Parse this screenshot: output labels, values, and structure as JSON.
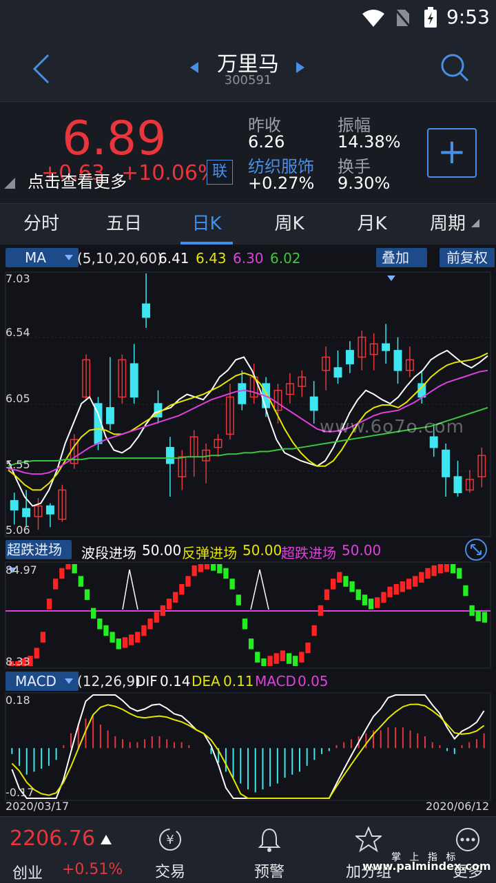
{
  "status_bar": {
    "time": "9:53"
  },
  "header": {
    "title": "万里马",
    "code": "300591"
  },
  "quote": {
    "price": "6.89",
    "change": "+0.63",
    "change_pct": "+10.06%",
    "link_badge": "联",
    "hint": "点击查看更多",
    "prev_close_label": "昨收",
    "prev_close": "6.26",
    "amplitude_label": "振幅",
    "amplitude": "14.38%",
    "sector": "纺织服饰",
    "sector_change": "+0.27%",
    "turnover_label": "换手",
    "turnover": "9.30%",
    "add_button": "+"
  },
  "tabs": [
    "分时",
    "五日",
    "日K",
    "周K",
    "月K",
    "周期"
  ],
  "active_tab": 2,
  "ma_panel": {
    "selector": "MA",
    "params": "(5,10,20,60)",
    "values": [
      "6.41",
      "6.43",
      "6.30",
      "6.02"
    ],
    "overlay_button": "叠加",
    "adjust_button": "前复权",
    "y_labels": [
      "7.03",
      "6.54",
      "6.05",
      "5.55",
      "5.06"
    ],
    "watermark": "www.6o7o.com"
  },
  "indicator_panel": {
    "selector": "超跌进场",
    "label1": "波段进场",
    "value1": "50.00",
    "label2": "反弹进场",
    "value2": "50.00",
    "label3": "超跌进场",
    "value3": "50.00",
    "y_top": "84.97",
    "y_bottom": "8.33"
  },
  "macd_panel": {
    "selector": "MACD",
    "params": "(12,26,9)",
    "dif_label": "DIF",
    "dif": "0.14",
    "dea_label": "DEA",
    "dea": "0.11",
    "macd_label": "MACD",
    "macd": "0.05",
    "y_top": "0.18",
    "y_bottom": "-0.17",
    "date_start": "2020/03/17",
    "date_end": "2020/06/12"
  },
  "bottom": {
    "index_value": "2206.76",
    "index_name": "创业",
    "index_change": "+0.51%",
    "nav": [
      "交易",
      "预警",
      "加分组",
      "更多"
    ],
    "watermark_cn": "掌 上 指 标",
    "watermark_url": "www.palmindex.com"
  },
  "colors": {
    "up": "#e8363c",
    "down": "#3ee6f2",
    "ma5": "#ffffff",
    "ma10": "#e6e600",
    "ma20": "#e040e0",
    "ma60": "#3cc83c",
    "accent": "#3d8ff0"
  },
  "chart_data": [
    {
      "type": "candlestick",
      "title": "",
      "ylim": [
        5.06,
        7.03
      ],
      "y_ticks": [
        7.03,
        6.54,
        6.05,
        5.55,
        5.06
      ],
      "x_range": [
        "2020/03/17",
        "2020/06/12"
      ],
      "series": [
        {
          "name": "MA5",
          "value": 6.41,
          "values": [
            5.62,
            5.48,
            5.35,
            5.28,
            5.3,
            5.4,
            5.55,
            5.75,
            5.9,
            6.05,
            6.1,
            5.98,
            5.8,
            5.7,
            5.68,
            5.72,
            5.8,
            5.9,
            5.98,
            6.0,
            6.02,
            6.08,
            6.12,
            6.1,
            6.08,
            6.15,
            6.25,
            6.3,
            6.38,
            6.4,
            6.3,
            6.15,
            5.95,
            5.78,
            5.68,
            5.65,
            5.62,
            5.6,
            5.58,
            5.62,
            5.72,
            5.85,
            5.98,
            6.08,
            6.15,
            6.12,
            6.08,
            6.05,
            6.1,
            6.18,
            6.25,
            6.3,
            6.38,
            6.42,
            6.45,
            6.4,
            6.35,
            6.32,
            6.36,
            6.41
          ]
        },
        {
          "name": "MA10",
          "value": 6.43,
          "values": [
            5.55,
            5.5,
            5.44,
            5.4,
            5.4,
            5.45,
            5.52,
            5.62,
            5.72,
            5.8,
            5.85,
            5.86,
            5.85,
            5.82,
            5.82,
            5.84,
            5.88,
            5.92,
            5.96,
            6.0,
            6.04,
            6.06,
            6.08,
            6.1,
            6.12,
            6.15,
            6.18,
            6.22,
            6.26,
            6.28,
            6.26,
            6.2,
            6.1,
            5.98,
            5.86,
            5.76,
            5.68,
            5.62,
            5.58,
            5.58,
            5.62,
            5.7,
            5.8,
            5.9,
            5.98,
            6.02,
            6.04,
            6.04,
            6.02,
            6.06,
            6.12,
            6.18,
            6.25,
            6.3,
            6.34,
            6.36,
            6.37,
            6.38,
            6.4,
            6.43
          ]
        },
        {
          "name": "MA20",
          "value": 6.3,
          "values": [
            5.56,
            5.55,
            5.53,
            5.52,
            5.52,
            5.53,
            5.56,
            5.6,
            5.64,
            5.68,
            5.72,
            5.75,
            5.78,
            5.8,
            5.82,
            5.84,
            5.86,
            5.88,
            5.9,
            5.92,
            5.94,
            5.96,
            5.99,
            6.02,
            6.05,
            6.08,
            6.1,
            6.12,
            6.14,
            6.15,
            6.14,
            6.12,
            6.1,
            6.06,
            6.02,
            5.98,
            5.94,
            5.9,
            5.86,
            5.84,
            5.84,
            5.85,
            5.87,
            5.9,
            5.93,
            5.96,
            5.98,
            5.99,
            6.0,
            6.03,
            6.06,
            6.1,
            6.14,
            6.18,
            6.21,
            6.23,
            6.25,
            6.27,
            6.29,
            6.3
          ]
        },
        {
          "name": "MA60",
          "value": 6.02,
          "values": [
            5.58,
            5.6,
            5.61,
            5.62,
            5.62,
            5.62,
            5.62,
            5.63,
            5.63,
            5.63,
            5.64,
            5.64,
            5.64,
            5.64,
            5.64,
            5.64,
            5.64,
            5.64,
            5.64,
            5.64,
            5.64,
            5.64,
            5.65,
            5.65,
            5.65,
            5.66,
            5.66,
            5.67,
            5.67,
            5.68,
            5.68,
            5.69,
            5.69,
            5.7,
            5.71,
            5.71,
            5.72,
            5.73,
            5.74,
            5.75,
            5.76,
            5.77,
            5.78,
            5.79,
            5.8,
            5.81,
            5.82,
            5.83,
            5.84,
            5.85,
            5.86,
            5.87,
            5.88,
            5.9,
            5.92,
            5.94,
            5.96,
            5.98,
            6.0,
            6.02
          ]
        }
      ],
      "candles": [
        [
          5.32,
          5.25,
          5.38,
          5.14
        ],
        [
          5.26,
          5.2,
          5.4,
          5.12
        ],
        [
          5.2,
          5.28,
          5.34,
          5.1
        ],
        [
          5.28,
          5.22,
          5.3,
          5.12
        ],
        [
          5.18,
          5.4,
          5.44,
          5.16
        ],
        [
          5.6,
          5.78,
          5.82,
          5.56
        ],
        [
          6.1,
          6.38,
          6.42,
          6.08
        ],
        [
          6.05,
          5.75,
          6.1,
          5.7
        ],
        [
          6.02,
          5.9,
          6.4,
          5.85
        ],
        [
          6.1,
          6.38,
          6.42,
          6.05
        ],
        [
          6.35,
          6.1,
          6.5,
          6.05
        ],
        [
          6.8,
          6.7,
          7.03,
          6.62
        ],
        [
          6.05,
          5.95,
          6.15,
          5.9
        ],
        [
          5.72,
          5.6,
          5.8,
          5.35
        ],
        [
          5.5,
          5.65,
          5.7,
          5.4
        ],
        [
          5.65,
          5.8,
          5.85,
          5.5
        ],
        [
          5.62,
          5.7,
          5.75,
          5.45
        ],
        [
          5.72,
          5.78,
          5.82,
          5.65
        ],
        [
          5.82,
          6.1,
          6.2,
          5.78
        ],
        [
          6.2,
          6.05,
          6.3,
          6.0
        ],
        [
          6.1,
          6.25,
          6.35,
          6.05
        ],
        [
          6.2,
          6.02,
          6.25,
          5.95
        ],
        [
          6.0,
          6.15,
          6.2,
          5.9
        ],
        [
          6.12,
          6.2,
          6.28,
          6.05
        ],
        [
          6.18,
          6.25,
          6.3,
          6.1
        ],
        [
          6.1,
          6.0,
          6.22,
          5.9
        ],
        [
          6.3,
          6.4,
          6.48,
          6.15
        ],
        [
          6.32,
          6.25,
          6.45,
          6.2
        ],
        [
          6.45,
          6.35,
          6.52,
          6.28
        ],
        [
          6.4,
          6.55,
          6.6,
          6.3
        ],
        [
          6.42,
          6.5,
          6.58,
          6.3
        ],
        [
          6.5,
          6.45,
          6.65,
          6.35
        ],
        [
          6.45,
          6.3,
          6.55,
          6.2
        ],
        [
          6.3,
          6.38,
          6.48,
          6.25
        ],
        [
          6.2,
          6.1,
          6.3,
          6.05
        ],
        [
          5.8,
          5.72,
          5.9,
          5.65
        ],
        [
          5.7,
          5.5,
          5.75,
          5.35
        ],
        [
          5.5,
          5.38,
          5.62,
          5.35
        ],
        [
          5.4,
          5.48,
          5.55,
          5.38
        ],
        [
          5.5,
          5.66,
          5.72,
          5.42
        ]
      ]
    },
    {
      "type": "bar",
      "title": "",
      "ylim": [
        8.33,
        84.97
      ],
      "series": [
        {
          "name": "波段进场",
          "value": 50.0
        },
        {
          "name": "反弹进场",
          "value": 50.0
        },
        {
          "name": "超跌进场",
          "value": 50.0
        }
      ],
      "values": [
        8,
        8,
        10,
        12,
        18,
        30,
        55,
        70,
        78,
        85,
        82,
        72,
        62,
        48,
        40,
        35,
        30,
        25,
        26,
        28,
        30,
        35,
        40,
        45,
        50,
        55,
        60,
        66,
        72,
        80,
        83,
        85,
        84,
        82,
        78,
        70,
        58,
        40,
        25,
        15,
        10,
        12,
        14,
        16,
        14,
        12,
        15,
        22,
        35,
        50,
        62,
        70,
        75,
        72,
        68,
        62,
        58,
        55,
        56,
        60,
        64,
        66,
        68,
        70,
        72,
        75,
        78,
        80,
        82,
        83,
        82,
        78,
        65,
        50,
        46,
        45
      ]
    },
    {
      "type": "bar",
      "title": "",
      "ylim": [
        -0.17,
        0.18
      ],
      "series": [
        {
          "name": "DIF",
          "value": 0.14
        },
        {
          "name": "DEA",
          "value": 0.11
        },
        {
          "name": "MACD",
          "value": 0.05
        }
      ],
      "macd": [
        -0.02,
        -0.06,
        -0.09,
        -0.08,
        -0.07,
        -0.06,
        -0.04,
        0.01,
        0.05,
        0.08,
        0.1,
        0.11,
        0.08,
        0.06,
        0.04,
        0.03,
        0.02,
        0.02,
        0.03,
        0.04,
        0.04,
        0.03,
        0.02,
        0.02,
        0.01,
        0.0,
        0.0,
        -0.02,
        -0.05,
        -0.08,
        -0.1,
        -0.12,
        -0.14,
        -0.15,
        -0.14,
        -0.13,
        -0.12,
        -0.1,
        -0.09,
        -0.08,
        -0.06,
        -0.04,
        -0.02,
        -0.01,
        0.01,
        0.02,
        0.03,
        0.04,
        0.05,
        0.06,
        0.06,
        0.07,
        0.07,
        0.07,
        0.06,
        0.05,
        0.04,
        0.02,
        0.01,
        -0.01,
        -0.02,
        0.01,
        0.02,
        0.03,
        0.05
      ]
    }
  ]
}
